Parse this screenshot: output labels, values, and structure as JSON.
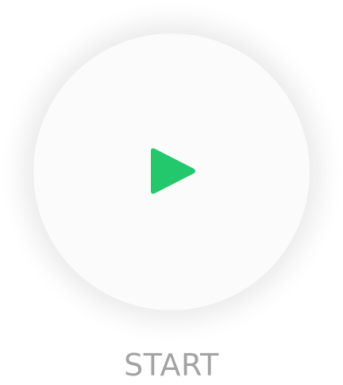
{
  "start": {
    "label": "START",
    "icon": "play-icon",
    "icon_color": "#22c86b",
    "label_color": "#a3a3a3",
    "button_bg": "#fbfbfc"
  }
}
